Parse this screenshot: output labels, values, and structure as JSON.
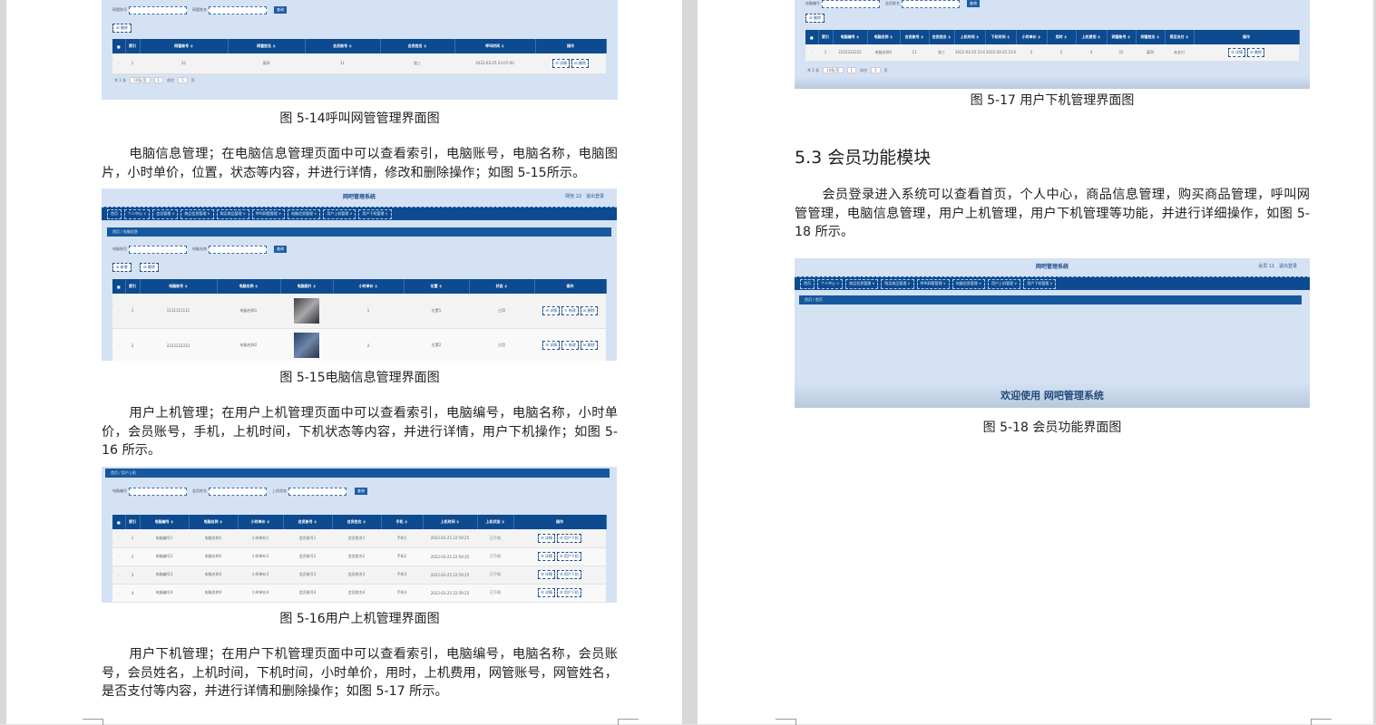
{
  "left": {
    "captions": {
      "fig14": "图 5-14呼叫网管管理界面图",
      "fig15": "图 5-15电脑信息管理界面图",
      "fig16": "图 5-16用户上机管理界面图"
    },
    "paragraphs": {
      "p1": "电脑信息管理；在电脑信息管理页面中可以查看索引，电脑账号，电脑名称，电脑图片，小时单价，位置，状态等内容，并进行详情，修改和删除操作；如图 5-15所示。",
      "p2": "用户上机管理；在用户上机管理页面中可以查看索引，电脑编号，电脑名称，小时单价，会员账号，手机，上机时间，下机状态等内容，并进行详情，用户下机操作；如图 5-16 所示。",
      "p3": "用户下机管理；在用户下机管理页面中可以查看索引，电脑编号，电脑名称，会员账号，会员姓名，上机时间，下机时间，小时单价，用时，上机费用，网管账号，网管姓名，是否支付等内容，并进行详情和删除操作；如图 5-17 所示。"
    },
    "shot14": {
      "search_labels": [
        "网管账号",
        "网管姓名"
      ],
      "search_button": "查询",
      "delete_button": "☒ 删除",
      "headers": [
        "",
        "索引",
        "网管账号 ≑",
        "网管姓名 ≑",
        "会员账号 ≑",
        "会员姓名 ≑",
        "呼叫时间 ≑",
        "操作"
      ],
      "rows": [
        [
          "",
          "1",
          "22",
          "某四",
          "11",
          "张三",
          "2022-03-25 23:07:00"
        ]
      ],
      "row_ops": [
        "☰ 详情",
        "☒ 删除"
      ],
      "pager": {
        "total": "共 1 条",
        "page_size": "10条/页",
        "page": "1",
        "goto": "前往",
        "unit": "页"
      }
    },
    "shot15": {
      "title": "网吧管理系统",
      "user": "网管 22",
      "logout": "退出登录",
      "nav": [
        "首页",
        "个人中心 ∨",
        "会员管理 ∨",
        "商品信息管理 ∨",
        "购买商品管理 ∨",
        "呼叫网管管理 ∨",
        "电脑信息管理 ∨",
        "用户上机管理 ∨",
        "用户下机管理 ∨"
      ],
      "breadcrumb": "首页 / 电脑信息",
      "search_labels": [
        "电脑账号",
        "电脑名称"
      ],
      "search_placeholders": [
        "电脑账号",
        "电脑名称"
      ],
      "search_button": "查询",
      "add_button": "⊕ 新增",
      "delete_button": "☒ 删除",
      "headers": [
        "",
        "索引",
        "电脑账号 ≑",
        "电脑名称 ≑",
        "电脑图片 ≑",
        "小时单价 ≑",
        "位置 ≑",
        "状态 ≑",
        "操作"
      ],
      "rows": [
        [
          "",
          "1",
          "1111111111",
          "电脑名称1",
          "",
          "1",
          "位置1",
          "占用"
        ],
        [
          "",
          "2",
          "2222222222",
          "电脑名称2",
          "",
          "2",
          "位置2",
          "占用"
        ]
      ],
      "row_ops": [
        "☰ 详情",
        "✎ 修改",
        "☒ 删除"
      ]
    },
    "shot16": {
      "breadcrumb": "首页 / 用户上机",
      "search_labels": [
        "电脑编号",
        "会员姓名",
        "上机状态"
      ],
      "search_button": "查询",
      "headers": [
        "",
        "索引",
        "电脑编号 ≑",
        "电脑名称 ≑",
        "小时单价 ≑",
        "会员账号 ≑",
        "会员姓名 ≑",
        "手机 ≑",
        "上机时间 ≑",
        "上机状态 ≑",
        "操作"
      ],
      "rows": [
        [
          "",
          "1",
          "电脑编号1",
          "电脑名称1",
          "小时单价1",
          "会员账号1",
          "会员姓名1",
          "手机1",
          "2022-03-25 22:59:25",
          "已下机"
        ],
        [
          "",
          "2",
          "电脑编号2",
          "电脑名称2",
          "小时单价2",
          "会员账号2",
          "会员姓名2",
          "手机2",
          "2022-03-25 22:59:25",
          "已下机"
        ],
        [
          "",
          "3",
          "电脑编号3",
          "电脑名称3",
          "小时单价3",
          "会员账号3",
          "会员姓名3",
          "手机3",
          "2022-03-25 22:59:25",
          "已下机"
        ],
        [
          "",
          "4",
          "电脑编号4",
          "电脑名称4",
          "小时单价4",
          "会员账号4",
          "会员姓名4",
          "手机4",
          "2022-03-25 22:59:25",
          "已下机"
        ]
      ],
      "row_ops": [
        "☰ 详情",
        "☰ 用户下机"
      ]
    }
  },
  "right": {
    "captions": {
      "fig17": "图 5-17 用户下机管理界面图",
      "fig18": "图 5-18 会员功能界面图"
    },
    "heading": "5.3  会员功能模块",
    "paragraph": "会员登录进入系统可以查看首页，个人中心，商品信息管理，购买商品管理，呼叫网管管理，电脑信息管理，用户上机管理，用户下机管理等功能，并进行详细操作，如图 5-18 所示。",
    "shot17": {
      "search_labels": [
        "电脑编号",
        "会员姓名"
      ],
      "search_button": "查询",
      "delete_button": "☒ 删除",
      "headers": [
        "",
        "索引",
        "电脑编号 ≑",
        "电脑名称 ≑",
        "会员账号 ≑",
        "会员姓名 ≑",
        "上机时间 ≑",
        "下机时间 ≑",
        "小时单价 ≑",
        "用时 ≑",
        "上机费用 ≑",
        "网管账号 ≑",
        "网管姓名 ≑",
        "是否支付 ≑",
        "操作"
      ],
      "rows": [
        [
          "",
          "1",
          "2222222222",
          "电脑名称2",
          "11",
          "张三",
          "2022-03-25 23:07:13",
          "2022-03-25 23:07:33",
          "2",
          "2",
          "4",
          "22",
          "某四",
          "未支付"
        ]
      ],
      "row_ops": [
        "☰ 详情",
        "☒ 删除"
      ],
      "pager": {
        "total": "共 1 条",
        "page_size": "10条/页",
        "page": "1",
        "goto": "前往",
        "unit": "页"
      }
    },
    "shot18": {
      "title": "网吧管理系统",
      "user": "会员 11",
      "logout": "退出登录",
      "nav": [
        "首页",
        "个人中心 ∨",
        "商品信息管理 ∨",
        "购买商品管理 ∨",
        "呼叫网管管理 ∨",
        "电脑信息管理 ∨",
        "用户上机管理 ∨",
        "用户下机管理 ∨"
      ],
      "breadcrumb": "首页 / 首页",
      "welcome": "欢迎使用 网吧管理系统"
    }
  }
}
